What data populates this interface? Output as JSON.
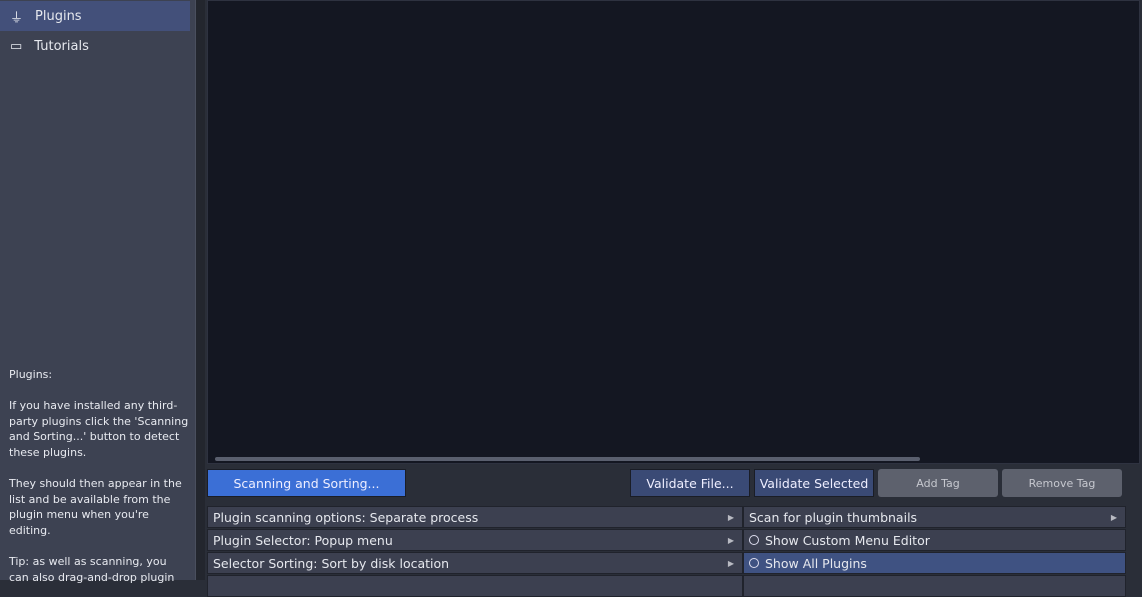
{
  "sidebar": {
    "items": [
      {
        "label": "Plugins",
        "icon": "plug-icon",
        "active": true
      },
      {
        "label": "Tutorials",
        "icon": "tutorials-icon",
        "active": false
      }
    ],
    "help_text": "Plugins:\n\nIf you have installed any third-party plugins click the 'Scanning and Sorting...' button to detect these plugins.\n\nThey should then appear in the list and be available from the plugin menu when you're editing.\n\nTip: as well as scanning, you can also drag-and-drop plugin"
  },
  "buttons": {
    "scan": "Scanning and Sorting...",
    "validate_file": "Validate File...",
    "validate_selected": "Validate Selected",
    "add_tag": "Add Tag",
    "remove_tag": "Remove Tag"
  },
  "options_left": [
    "Plugin scanning options: Separate process",
    "Plugin Selector: Popup menu",
    "Selector Sorting: Sort by disk location"
  ],
  "options_right": [
    "Scan for plugin thumbnails",
    "Show Custom Menu Editor",
    "Show All Plugins"
  ],
  "colors": {
    "accent": "#3b6fd6",
    "selected": "#3f5282"
  }
}
